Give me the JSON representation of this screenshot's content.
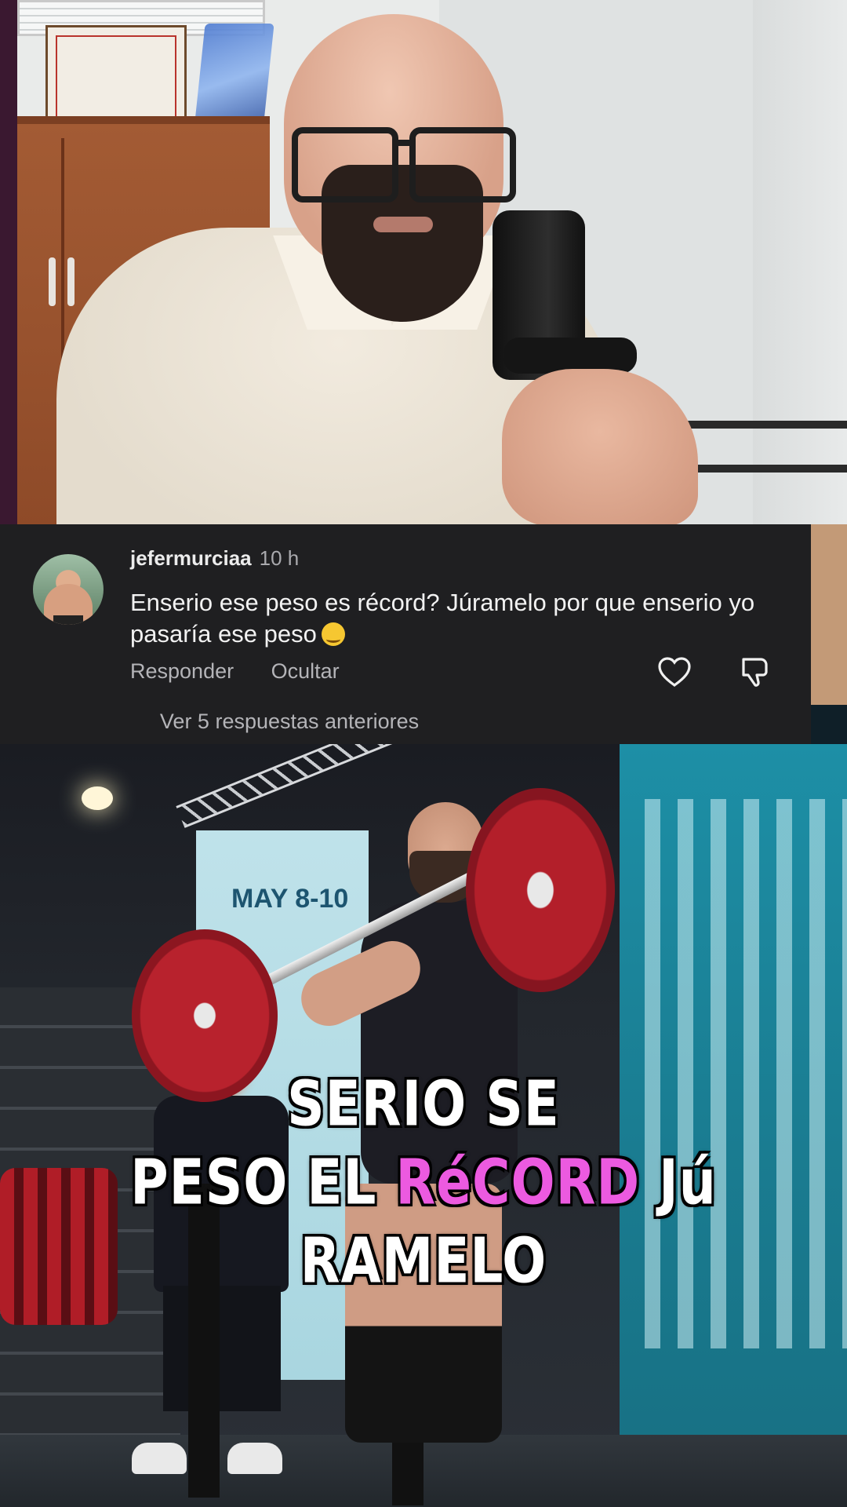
{
  "comment": {
    "username": "jefermurciaa",
    "time": "10 h",
    "text": "Enserio ese peso es récord? Júramelo por que enserio yo pasaría ese peso",
    "reply_label": "Responder",
    "hide_label": "Ocultar",
    "more_replies": "Ver 5 respuestas anteriores"
  },
  "background": {
    "banner_date": "MAY 8-10"
  },
  "caption": {
    "line1": "SERIO SE",
    "line2_a": "PESO EL ",
    "line2_highlight": "RéCORD",
    "line2_b": " Jú",
    "line3": "RAMELO",
    "highlight_color": "#ec5ae0"
  },
  "icons": [
    "heart-icon",
    "dislike-icon",
    "emoji-icon"
  ],
  "colors": {
    "card_bg": "#1f1f21",
    "muted_text": "#b4b4b8"
  }
}
